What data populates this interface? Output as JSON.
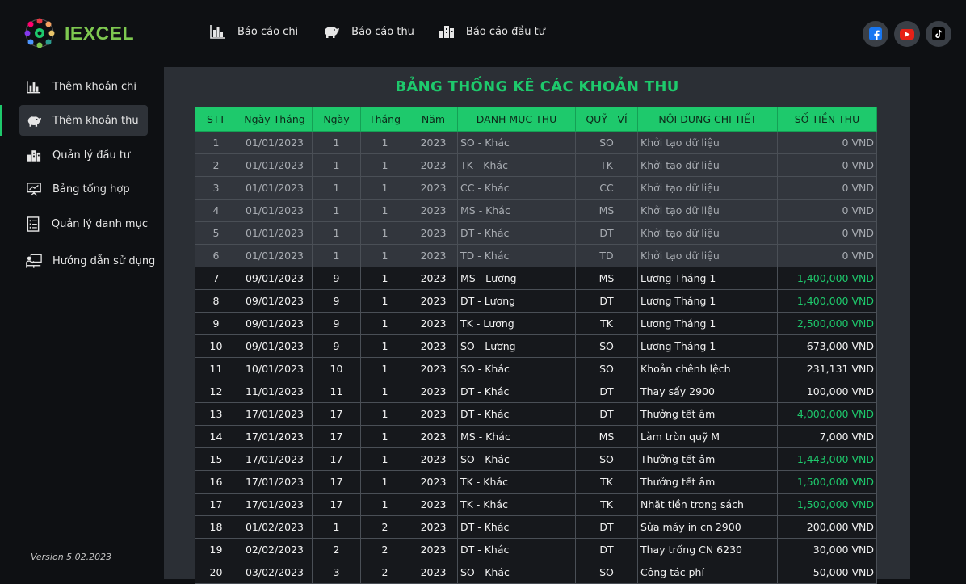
{
  "app": {
    "brand": "IEXCEL",
    "version": "Version 5.02.2023"
  },
  "topnav": [
    {
      "label": "Báo cáo chi",
      "icon": "bar-chart-icon"
    },
    {
      "label": "Báo cáo thu",
      "icon": "piggy-bank-icon"
    },
    {
      "label": "Báo cáo đầu tư",
      "icon": "buildings-icon"
    }
  ],
  "social": [
    {
      "icon": "facebook-icon",
      "color": "#1877f2"
    },
    {
      "icon": "youtube-icon",
      "color": "#e62117"
    },
    {
      "icon": "tiktok-icon",
      "color": "#000000"
    }
  ],
  "sidebar": [
    {
      "label": "Thêm khoản chi",
      "icon": "bar-chart-icon"
    },
    {
      "label": "Thêm khoản thu",
      "icon": "piggy-bank-icon",
      "active": true
    },
    {
      "label": "Quản lý đầu tư",
      "icon": "buildings-icon"
    },
    {
      "label": "Bảng tổng hợp",
      "icon": "presentation-board-icon"
    },
    {
      "label": "Quản lý danh mục",
      "icon": "list-document-icon"
    },
    {
      "label": "Hướng dẫn sử dụng",
      "icon": "teacher-icon"
    }
  ],
  "table": {
    "title": "BẢNG THỐNG KÊ CÁC KHOẢN THU",
    "headers": [
      "STT",
      "Ngày Tháng",
      "Ngày",
      "Tháng",
      "Năm",
      "DANH MỤC THU",
      "QUỸ - VÍ",
      "NỘI DUNG CHI TIẾT",
      "SỐ TIỀN THU"
    ],
    "rows": [
      {
        "stt": "1",
        "date": "01/01/2023",
        "day": "1",
        "month": "1",
        "year": "2023",
        "category": "SO - Khác",
        "fund": "SO",
        "detail": "Khởi tạo dữ liệu",
        "amount": "0 VND",
        "init": true
      },
      {
        "stt": "2",
        "date": "01/01/2023",
        "day": "1",
        "month": "1",
        "year": "2023",
        "category": "TK - Khác",
        "fund": "TK",
        "detail": "Khởi tạo dữ liệu",
        "amount": "0 VND",
        "init": true
      },
      {
        "stt": "3",
        "date": "01/01/2023",
        "day": "1",
        "month": "1",
        "year": "2023",
        "category": "CC - Khác",
        "fund": "CC",
        "detail": "Khởi tạo dữ liệu",
        "amount": "0 VND",
        "init": true
      },
      {
        "stt": "4",
        "date": "01/01/2023",
        "day": "1",
        "month": "1",
        "year": "2023",
        "category": "MS - Khác",
        "fund": "MS",
        "detail": "Khởi tạo dữ liệu",
        "amount": "0 VND",
        "init": true
      },
      {
        "stt": "5",
        "date": "01/01/2023",
        "day": "1",
        "month": "1",
        "year": "2023",
        "category": "DT - Khác",
        "fund": "DT",
        "detail": "Khởi tạo dữ liệu",
        "amount": "0 VND",
        "init": true
      },
      {
        "stt": "6",
        "date": "01/01/2023",
        "day": "1",
        "month": "1",
        "year": "2023",
        "category": "TD - Khác",
        "fund": "TD",
        "detail": "Khởi tạo dữ liệu",
        "amount": "0 VND",
        "init": true
      },
      {
        "stt": "7",
        "date": "09/01/2023",
        "day": "9",
        "month": "1",
        "year": "2023",
        "category": "MS - Lương",
        "fund": "MS",
        "detail": "Lương Tháng 1",
        "amount": "1,400,000 VND",
        "highlight": true
      },
      {
        "stt": "8",
        "date": "09/01/2023",
        "day": "9",
        "month": "1",
        "year": "2023",
        "category": "DT - Lương",
        "fund": "DT",
        "detail": "Lương Tháng 1",
        "amount": "1,400,000 VND",
        "highlight": true
      },
      {
        "stt": "9",
        "date": "09/01/2023",
        "day": "9",
        "month": "1",
        "year": "2023",
        "category": "TK - Lương",
        "fund": "TK",
        "detail": "Lương Tháng 1",
        "amount": "2,500,000 VND",
        "highlight": true
      },
      {
        "stt": "10",
        "date": "09/01/2023",
        "day": "9",
        "month": "1",
        "year": "2023",
        "category": "SO - Lương",
        "fund": "SO",
        "detail": "Lương Tháng 1",
        "amount": "673,000 VND"
      },
      {
        "stt": "11",
        "date": "10/01/2023",
        "day": "10",
        "month": "1",
        "year": "2023",
        "category": "SO - Khác",
        "fund": "SO",
        "detail": "Khoản chênh lệch",
        "amount": "231,131 VND"
      },
      {
        "stt": "12",
        "date": "11/01/2023",
        "day": "11",
        "month": "1",
        "year": "2023",
        "category": "DT - Khác",
        "fund": "DT",
        "detail": "Thay sấy 2900",
        "amount": "100,000 VND"
      },
      {
        "stt": "13",
        "date": "17/01/2023",
        "day": "17",
        "month": "1",
        "year": "2023",
        "category": "DT - Khác",
        "fund": "DT",
        "detail": "Thưởng tết âm",
        "amount": "4,000,000 VND",
        "highlight": true
      },
      {
        "stt": "14",
        "date": "17/01/2023",
        "day": "17",
        "month": "1",
        "year": "2023",
        "category": "MS - Khác",
        "fund": "MS",
        "detail": "Làm tròn quỹ M",
        "amount": "7,000 VND"
      },
      {
        "stt": "15",
        "date": "17/01/2023",
        "day": "17",
        "month": "1",
        "year": "2023",
        "category": "SO - Khác",
        "fund": "SO",
        "detail": "Thưởng tết âm",
        "amount": "1,443,000 VND",
        "highlight": true
      },
      {
        "stt": "16",
        "date": "17/01/2023",
        "day": "17",
        "month": "1",
        "year": "2023",
        "category": "TK - Khác",
        "fund": "TK",
        "detail": "Thưởng tết âm",
        "amount": "1,500,000 VND",
        "highlight": true
      },
      {
        "stt": "17",
        "date": "17/01/2023",
        "day": "17",
        "month": "1",
        "year": "2023",
        "category": "TK - Khác",
        "fund": "TK",
        "detail": "Nhặt tiền trong sách",
        "amount": "1,500,000 VND",
        "highlight": true
      },
      {
        "stt": "18",
        "date": "01/02/2023",
        "day": "1",
        "month": "2",
        "year": "2023",
        "category": "DT - Khác",
        "fund": "DT",
        "detail": "Sửa máy in cn 2900",
        "amount": "200,000 VND"
      },
      {
        "stt": "19",
        "date": "02/02/2023",
        "day": "2",
        "month": "2",
        "year": "2023",
        "category": "DT - Khác",
        "fund": "DT",
        "detail": "Thay trống CN 6230",
        "amount": "30,000 VND"
      },
      {
        "stt": "20",
        "date": "03/02/2023",
        "day": "3",
        "month": "2",
        "year": "2023",
        "category": "SO - Khác",
        "fund": "SO",
        "detail": "Công tác phí",
        "amount": "50,000 VND"
      }
    ]
  },
  "colors": {
    "accent": "#1ec96c",
    "brand": "#7ec850",
    "background": "#0e1013",
    "panel": "#2b2f35"
  }
}
